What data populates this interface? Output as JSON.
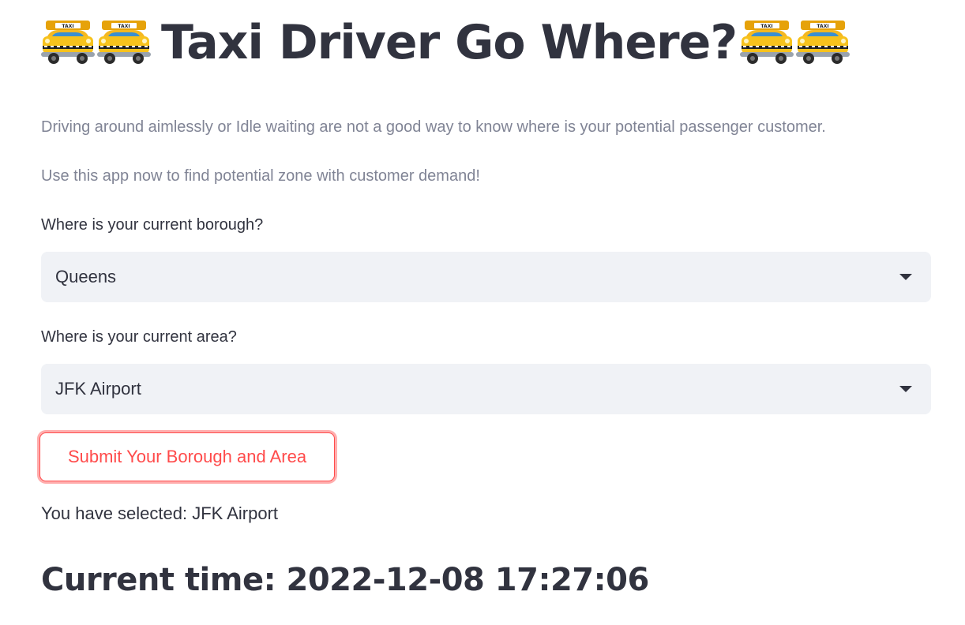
{
  "header": {
    "title": "Taxi Driver Go Where?",
    "icon": "taxi-emoji"
  },
  "description": {
    "line1": "Driving around aimlessly or Idle waiting are not a good way to know where is your potential passenger customer.",
    "line2": "Use this app now to find potential zone with customer demand!"
  },
  "form": {
    "borough": {
      "label": "Where is your current borough?",
      "value": "Queens"
    },
    "area": {
      "label": "Where is your current area?",
      "value": "JFK Airport"
    },
    "submit_label": "Submit Your Borough and Area"
  },
  "result": {
    "selected_text": "You have selected: JFK Airport",
    "current_time": "Current time: 2022-12-08 17:27:06"
  },
  "colors": {
    "accent": "#ff4b4b",
    "text": "#31333f",
    "muted": "#808495",
    "select_bg": "#f0f2f6"
  }
}
